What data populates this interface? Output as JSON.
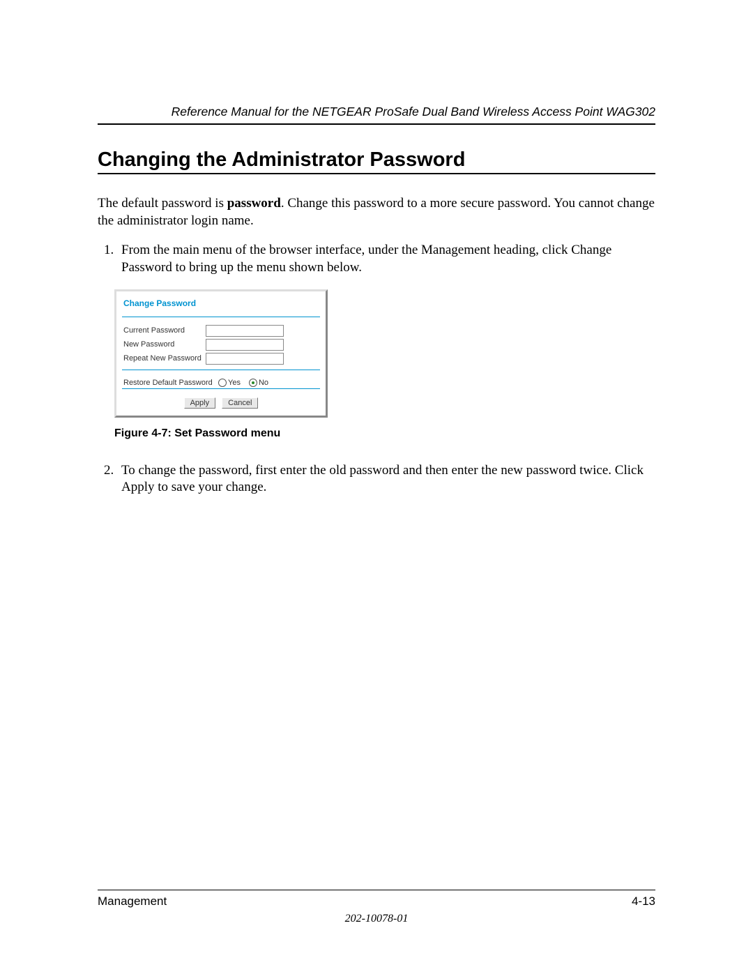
{
  "header": {
    "running_head": "Reference Manual for the NETGEAR ProSafe Dual Band Wireless Access Point WAG302"
  },
  "section": {
    "title": "Changing the Administrator Password",
    "intro_pre": "The default password is ",
    "intro_bold": "password",
    "intro_post": ". Change this password to a more secure password. You cannot change the administrator login name.",
    "step1": "From the main menu of the browser interface, under the Management heading, click Change Password to bring up the menu shown below.",
    "step2": "To change the password, first enter the old password and then enter the new password twice. Click Apply to save your change."
  },
  "panel": {
    "title": "Change Password",
    "fields": {
      "current": "Current Password",
      "new": "New Password",
      "repeat": "Repeat New Password"
    },
    "restore_label": "Restore Default Password",
    "radio_yes": "Yes",
    "radio_no": "No",
    "apply": "Apply",
    "cancel": "Cancel"
  },
  "figure": {
    "caption": "Figure 4-7:  Set Password menu"
  },
  "footer": {
    "section": "Management",
    "page": "4-13",
    "docnum": "202-10078-01"
  }
}
